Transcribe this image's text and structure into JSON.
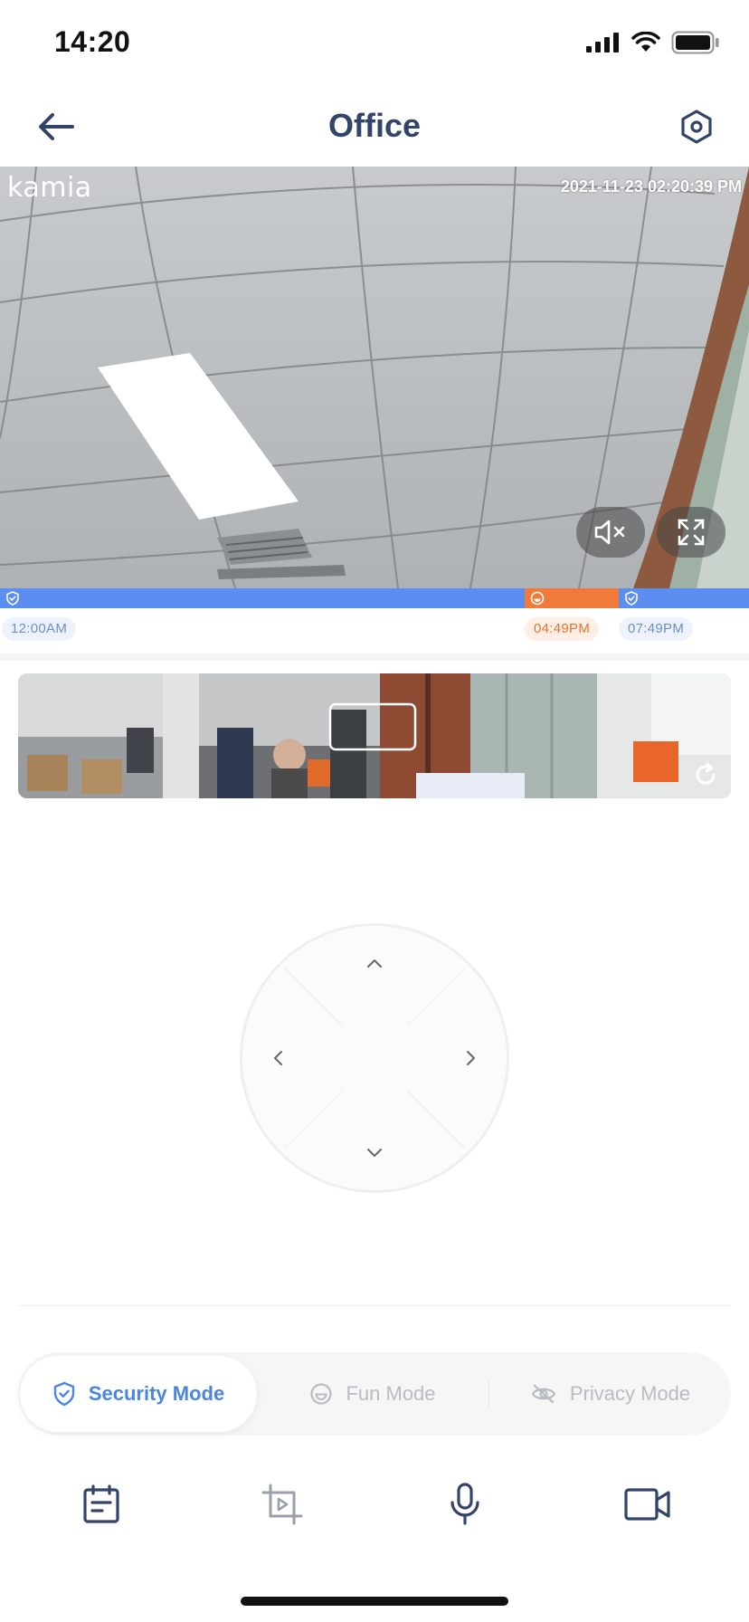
{
  "status_bar": {
    "time": "14:20"
  },
  "header": {
    "title": "Office"
  },
  "video": {
    "brand": "kamia",
    "timestamp": "2021-11-23 02:20:39 PM"
  },
  "timeline": {
    "segments": [
      {
        "mode": "security",
        "icon": "shield-icon",
        "color": "#5b8ef0"
      },
      {
        "mode": "fun",
        "icon": "smile-icon",
        "color": "#f07a3a"
      },
      {
        "mode": "security",
        "icon": "shield-icon",
        "color": "#5b8ef0"
      }
    ],
    "labels": [
      "12:00AM",
      "04:49PM",
      "07:49PM"
    ]
  },
  "modes": [
    {
      "label": "Security Mode",
      "icon": "shield-icon",
      "active": true
    },
    {
      "label": "Fun Mode",
      "icon": "smile-icon",
      "active": false
    },
    {
      "label": "Privacy Mode",
      "icon": "eye-off-icon",
      "active": false
    }
  ],
  "toolbar": [
    "calendar-icon",
    "video-clip-icon",
    "microphone-icon",
    "video-camera-icon"
  ],
  "colors": {
    "accent": "#4a86df",
    "fun": "#f07a3a",
    "title": "#33446b"
  }
}
